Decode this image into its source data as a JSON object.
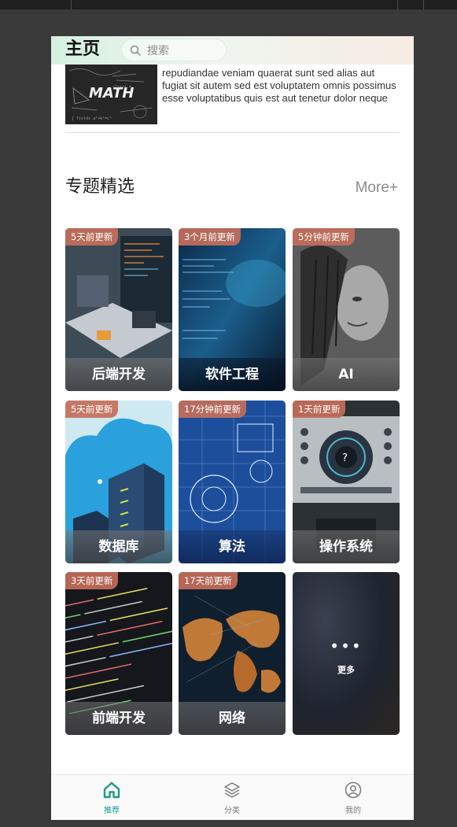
{
  "header": {
    "title": "主页",
    "search_placeholder": "搜索"
  },
  "article": {
    "image_text": "MATH",
    "excerpt": "repudiandae veniam quaerat sunt sed alias aut fugiat sit autem sed est voluptatem omnis possimus esse voluptatibus quis est aut tenetur dolor neque"
  },
  "section": {
    "title": "专题精选",
    "more": "More+"
  },
  "topics": [
    {
      "badge": "5天前更新",
      "label": "后端开发"
    },
    {
      "badge": "3个月前更新",
      "label": "软件工程"
    },
    {
      "badge": "5分钟前更新",
      "label": "AI"
    },
    {
      "badge": "5天前更新",
      "label": "数据库"
    },
    {
      "badge": "17分钟前更新",
      "label": "算法"
    },
    {
      "badge": "1天前更新",
      "label": "操作系统"
    },
    {
      "badge": "3天前更新",
      "label": "前端开发"
    },
    {
      "badge": "17天前更新",
      "label": "网络"
    }
  ],
  "more_card": {
    "dots": "•••",
    "label": "更多"
  },
  "tabbar": {
    "items": [
      {
        "label": "推荐",
        "icon": "home-icon",
        "active": true
      },
      {
        "label": "分类",
        "icon": "layers-icon",
        "active": false
      },
      {
        "label": "我的",
        "icon": "user-icon",
        "active": false
      }
    ],
    "accent": "#1a9b8e"
  },
  "colors": {
    "badge_bg": "#c46e5a",
    "header_gradient_start": "#d6f1e0",
    "header_gradient_end": "#f7ece4"
  }
}
